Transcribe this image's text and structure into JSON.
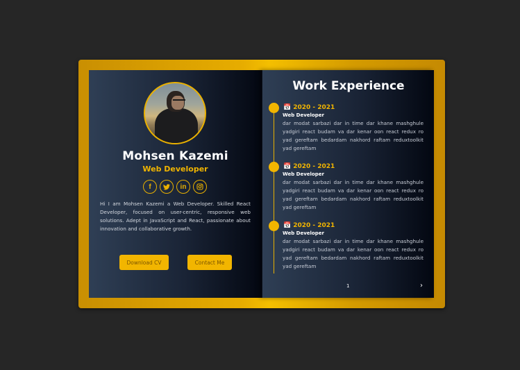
{
  "profile": {
    "name": "Mohsen Kazemi",
    "role": "Web Developer",
    "bio": "Hi I am Mohsen Kazemi a Web Developer. Skilled React Developer, focused on user-centric, responsive web solutions. Adept in JavaScript and React, passionate about innovation and collaborative growth."
  },
  "socials": [
    {
      "icon": "facebook-icon",
      "glyph": "f"
    },
    {
      "icon": "twitter-icon",
      "glyph": "🐦"
    },
    {
      "icon": "linkedin-icon",
      "glyph": "in"
    },
    {
      "icon": "instagram-icon",
      "glyph": "◎"
    }
  ],
  "buttons": {
    "download_cv": "Download CV",
    "contact_me": "Contact Me"
  },
  "experience": {
    "title": "Work Experience",
    "entries": [
      {
        "date": "2020 - 2021",
        "job": "Web Developer",
        "desc": "dar modat sarbazi dar in time dar khane mashghule yadgiri react budam va dar kenar oon react redux ro yad gereftam bedardam nakhord raftam reduxtoolkit yad gereftam"
      },
      {
        "date": "2020 - 2021",
        "job": "Web Developer",
        "desc": "dar modat sarbazi dar in time dar khane mashghule yadgiri react budam va dar kenar oon react redux ro yad gereftam bedardam nakhord raftam reduxtoolkit yad gereftam"
      },
      {
        "date": "2020 - 2021",
        "job": "Web Developer",
        "desc": "dar modat sarbazi dar in time dar khane mashghule yadgiri react budam va dar kenar oon react redux ro yad gereftam bedardam nakhord raftam reduxtoolkit yad gereftam"
      }
    ]
  },
  "pagination": {
    "page": "1",
    "next": "›"
  },
  "colors": {
    "accent": "#f2b500",
    "background": "#262626"
  }
}
